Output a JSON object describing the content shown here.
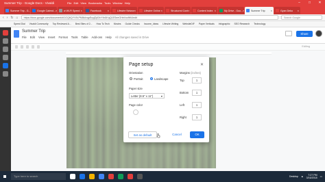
{
  "window": {
    "title": "Summer Trip - Google Docs - Vivaldi",
    "menu": [
      "File",
      "Edit",
      "View",
      "Bookmarks",
      "Tools",
      "Window",
      "Help"
    ],
    "controls": [
      "–",
      "□",
      "✕"
    ]
  },
  "tabs": [
    {
      "label": "Summer Trip - G...",
      "color": "#4285f4",
      "active": false
    },
    {
      "label": "Google Calend...",
      "color": "#1a73e8",
      "active": false
    },
    {
      "label": "w Wi-Fi Speed",
      "color": "#999999",
      "active": false
    },
    {
      "label": "Facebook",
      "color": "#3b5998",
      "active": false
    },
    {
      "label": "Lifewire Networ",
      "color": "#e23f3c",
      "active": false
    },
    {
      "label": "Lifewire Online",
      "color": "#e23f3c",
      "active": false
    },
    {
      "label": "Structured Cont",
      "color": "#e23f3c",
      "active": false
    },
    {
      "label": "Content Index",
      "color": "#e23f3c",
      "active": false
    },
    {
      "label": "My Drive - Goo...",
      "color": "#0f9d58",
      "active": false
    },
    {
      "label": "Summer Trip",
      "color": "#4285f4",
      "active": true
    },
    {
      "label": "Gyan Deko",
      "color": "#e23f3c",
      "active": false
    }
  ],
  "address": {
    "url": "https://docs.google.com/document/d/1GQ6QYV9LPM8k4rqpEuyjDj43vY9d1KqQ1ESeeGHeVxzfW4/edit",
    "search_placeholder": "Search Google"
  },
  "bookmarks": [
    "Speed Dial",
    "Vivaldi Community",
    "Top Reviewed A...",
    "Best Sites of 2...",
    "How To Tech",
    "Movies",
    "Guide Checks",
    "Income_Ideas",
    "Lifewire Writing",
    "WebsiteDIF",
    "Paper Verticals",
    "Infographic",
    "SEO Research",
    "Technology"
  ],
  "sidebar_icons": [
    "#e23f3c",
    "#888888",
    "#888888",
    "#888888",
    "#1a73e8",
    "#888888"
  ],
  "docs": {
    "title": "Summer Trip",
    "menu": [
      "File",
      "Edit",
      "View",
      "Insert",
      "Format",
      "Tools",
      "Table",
      "Add-ons",
      "Help"
    ],
    "saved": "All changes saved in Drive",
    "share": "Share",
    "editing": "Editing"
  },
  "dialog": {
    "title": "Page setup",
    "orientation_label": "Orientation",
    "portrait": "Portrait",
    "landscape": "Landscape",
    "paper_size_label": "Paper size",
    "paper_size_value": "Letter (8.5\" x 11\")",
    "page_color_label": "Page color",
    "margins_label": "Margins",
    "margins_unit": "(inches)",
    "margins": [
      {
        "name": "Top",
        "value": "1"
      },
      {
        "name": "Bottom",
        "value": "1"
      },
      {
        "name": "Left",
        "value": "1"
      },
      {
        "name": "Right",
        "value": "1"
      }
    ],
    "set_default": "Set as default",
    "cancel": "Cancel",
    "ok": "OK"
  },
  "taskbar": {
    "search_placeholder": "Type here to search",
    "tray_label": "Desktop",
    "time": "7:27 PM",
    "date": "3/16/2018",
    "app_colors": [
      "#ffffff",
      "#1a73e8",
      "#f4b400",
      "#4285f4",
      "#e23f3c",
      "#0f9d58",
      "#e23f3c",
      "#555555"
    ]
  }
}
